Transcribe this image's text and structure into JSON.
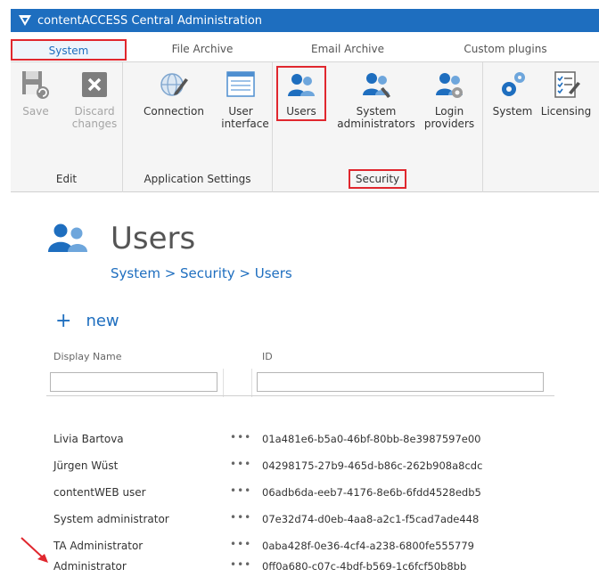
{
  "window": {
    "title": "contentACCESS Central Administration"
  },
  "tabs": [
    {
      "label": "System",
      "active": true
    },
    {
      "label": "File Archive"
    },
    {
      "label": "Email Archive"
    },
    {
      "label": "Custom plugins"
    }
  ],
  "ribbon": {
    "edit": {
      "label": "Edit",
      "save": "Save",
      "discard_1": "Discard",
      "discard_2": "changes"
    },
    "app_settings": {
      "label": "Application Settings",
      "connection": "Connection",
      "ui_1": "User",
      "ui_2": "interface"
    },
    "security": {
      "label": "Security",
      "users": "Users",
      "sysadmins_1": "System",
      "sysadmins_2": "administrators",
      "login_1": "Login",
      "login_2": "providers"
    },
    "system_group": {
      "system": "System",
      "licensing": "Licensing"
    }
  },
  "page": {
    "title": "Users",
    "breadcrumb": "System > Security > Users",
    "new_label": "new"
  },
  "table": {
    "columns": {
      "display_name": "Display Name",
      "id": "ID"
    },
    "rows": [
      {
        "name": "Livia Bartova",
        "actions": "•••",
        "id": "01a481e6-b5a0-46bf-80bb-8e3987597e00"
      },
      {
        "name": "Jürgen Wüst",
        "actions": "•••",
        "id": "04298175-27b9-465d-b86c-262b908a8cdc"
      },
      {
        "name": "contentWEB user",
        "actions": "•••",
        "id": "06adb6da-eeb7-4176-8e6b-6fdd4528edb5"
      },
      {
        "name": "System administrator",
        "actions": "•••",
        "id": "07e32d74-d0eb-4aa8-a2c1-f5cad7ade448"
      },
      {
        "name": "TA Administrator",
        "actions": "•••",
        "id": "0aba428f-0e36-4cf4-a238-6800fe555779"
      },
      {
        "name": "Administrator",
        "actions": "•••",
        "id": "0ff0a680-c07c-4bdf-b569-1c6fcf50b8bb"
      }
    ]
  },
  "colors": {
    "accent": "#1e6ebf",
    "highlight": "#e0272e"
  }
}
